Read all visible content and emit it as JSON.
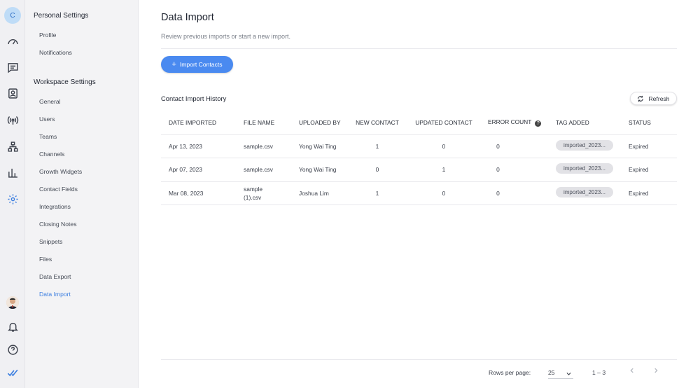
{
  "rail": {
    "avatar_initial": "C",
    "icons": [
      "dashboard-icon",
      "messages-icon",
      "contacts-icon",
      "broadcast-icon",
      "workflows-icon",
      "reports-icon",
      "settings-icon"
    ],
    "bottom_icons": [
      "user-avatar",
      "bell-icon",
      "help-icon",
      "brand-check-icon"
    ]
  },
  "sidebar": {
    "personal_heading": "Personal Settings",
    "personal_items": [
      "Profile",
      "Notifications"
    ],
    "workspace_heading": "Workspace Settings",
    "workspace_items": [
      "General",
      "Users",
      "Teams",
      "Channels",
      "Growth Widgets",
      "Contact Fields",
      "Integrations",
      "Closing Notes",
      "Snippets",
      "Files",
      "Data Export",
      "Data Import"
    ],
    "active_item": "Data Import"
  },
  "page": {
    "title": "Data Import",
    "description": "Review previous imports or start a new import.",
    "import_button": "Import Contacts",
    "section_title": "Contact Import History",
    "refresh_button": "Refresh"
  },
  "table": {
    "columns": [
      "DATE IMPORTED",
      "FILE NAME",
      "UPLOADED BY",
      "NEW CONTACT",
      "UPDATED CONTACT",
      "ERROR COUNT",
      "TAG ADDED",
      "STATUS"
    ],
    "rows": [
      {
        "date": "Apr 13, 2023",
        "file": "sample.csv",
        "uploaded_by": "Yong Wai Ting",
        "new": "1",
        "updated": "0",
        "errors": "0",
        "tag": "imported_2023...",
        "status": "Expired"
      },
      {
        "date": "Apr 07, 2023",
        "file": "sample.csv",
        "uploaded_by": "Yong Wai Ting",
        "new": "0",
        "updated": "1",
        "errors": "0",
        "tag": "imported_2023...",
        "status": "Expired"
      },
      {
        "date": "Mar 08, 2023",
        "file": "sample (1).csv",
        "uploaded_by": "Joshua Lim",
        "new": "1",
        "updated": "0",
        "errors": "0",
        "tag": "imported_2023...",
        "status": "Expired"
      }
    ]
  },
  "pagination": {
    "rows_per_page_label": "Rows per page:",
    "rows_per_page_value": "25",
    "range": "1 – 3"
  },
  "colors": {
    "accent": "#4a8af0",
    "active_link": "#3d7fe0",
    "sidebar_bg": "#f3f3f5"
  }
}
